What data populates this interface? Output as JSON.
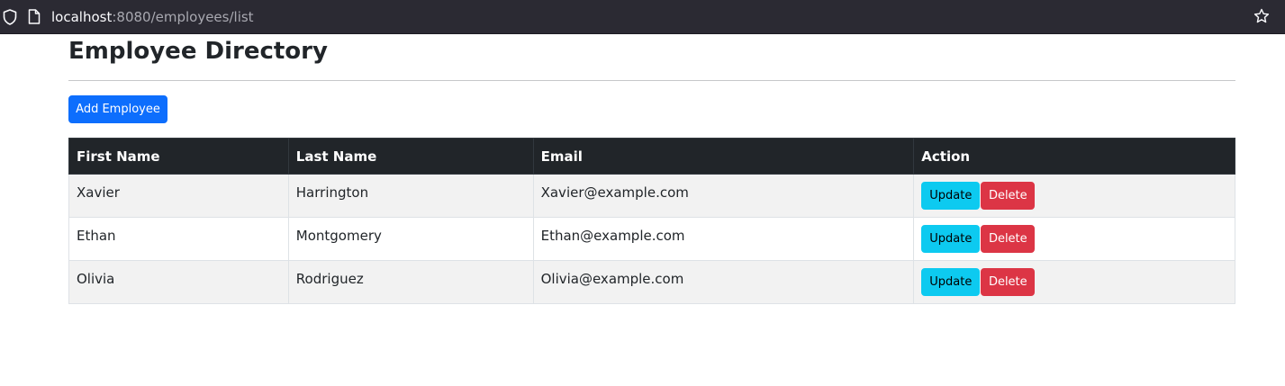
{
  "browser": {
    "url_host": "localhost",
    "url_path": ":8080/employees/list",
    "shield_icon": "shield-icon",
    "page_icon": "page-icon",
    "bookmark_icon": "star-icon"
  },
  "page": {
    "title": "Employee Directory",
    "add_button_label": "Add Employee"
  },
  "table": {
    "headers": [
      "First Name",
      "Last Name",
      "Email",
      "Action"
    ],
    "rows": [
      {
        "first_name": "Xavier",
        "last_name": "Harrington",
        "email": "Xavier@example.com"
      },
      {
        "first_name": "Ethan",
        "last_name": "Montgomery",
        "email": "Ethan@example.com"
      },
      {
        "first_name": "Olivia",
        "last_name": "Rodriguez",
        "email": "Olivia@example.com"
      }
    ],
    "update_label": "Update",
    "delete_label": "Delete"
  },
  "colors": {
    "primary": "#0d6efd",
    "info": "#0dcaf0",
    "danger": "#dc3545",
    "table_header": "#212529",
    "stripe": "#f2f2f2"
  }
}
